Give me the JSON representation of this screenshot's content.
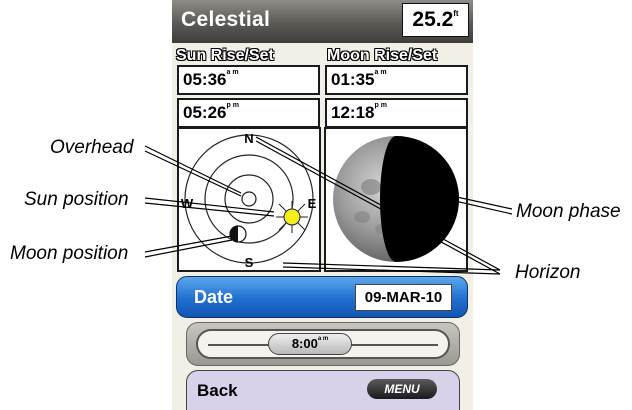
{
  "header": {
    "title": "Celestial",
    "depth_value": "25.2",
    "depth_unit": "ft"
  },
  "sun": {
    "heading": "Sun Rise/Set",
    "rise": "05:36",
    "rise_suffix": "a m",
    "set": "05:26",
    "set_suffix": "p m"
  },
  "moon": {
    "heading": "Moon Rise/Set",
    "rise": "01:35",
    "rise_suffix": "a m",
    "set": "12:18",
    "set_suffix": "p m"
  },
  "compass": {
    "n": "N",
    "s": "S",
    "e": "E",
    "w": "W"
  },
  "date": {
    "label": "Date",
    "value": "09-MAR-10"
  },
  "time_slider": {
    "value": "8:00",
    "suffix": "a m"
  },
  "footer": {
    "back_label": "Back",
    "menu_label": "MENU"
  },
  "callouts": {
    "overhead": "Overhead",
    "sun_position": "Sun position",
    "moon_position": "Moon position",
    "moon_phase": "Moon phase",
    "horizon": "Horizon"
  },
  "colors": {
    "date_bar": "#1f6fd0",
    "sun_icon": "#f2ef1c",
    "back_bar": "#d9d1ea"
  }
}
